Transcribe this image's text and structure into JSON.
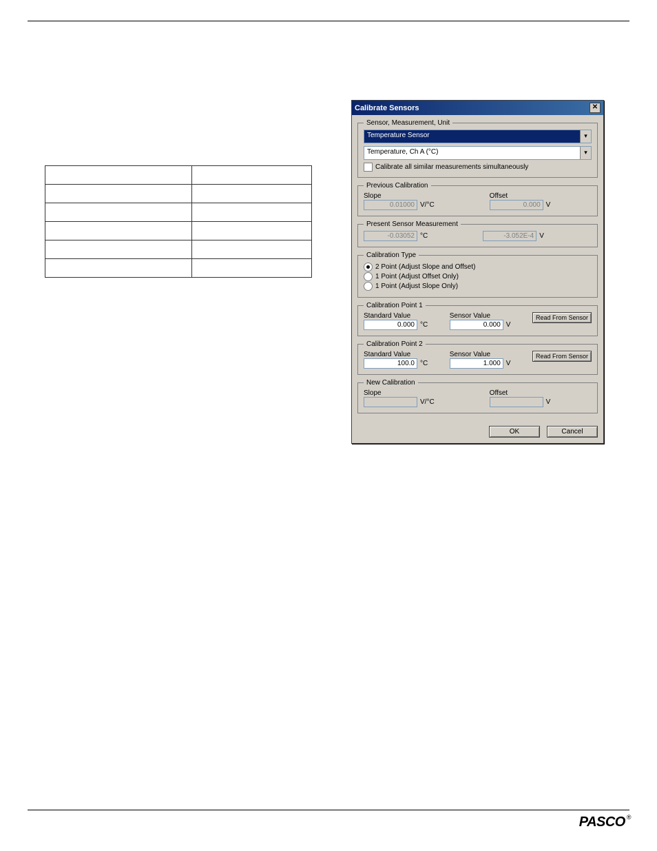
{
  "dialog": {
    "title": "Calibrate Sensors",
    "close_glyph": "✕",
    "smu": {
      "legend": "Sensor, Measurement, Unit",
      "sensor": "Temperature Sensor",
      "measurement": "Temperature, Ch A (°C)",
      "checkbox_label": "Calibrate all similar measurements simultaneously"
    },
    "prev_cal": {
      "legend": "Previous Calibration",
      "slope_label": "Slope",
      "slope_value": "0.01000",
      "slope_unit": "V/°C",
      "offset_label": "Offset",
      "offset_value": "0.000",
      "offset_unit": "V"
    },
    "present": {
      "legend": "Present Sensor Measurement",
      "value": "-0.03052",
      "unit": "°C",
      "raw_value": "-3.052E-4",
      "raw_unit": "V"
    },
    "cal_type": {
      "legend": "Calibration Type",
      "opt1": "2 Point (Adjust Slope and Offset)",
      "opt2": "1 Point (Adjust Offset Only)",
      "opt3": "1 Point (Adjust Slope Only)"
    },
    "cp1": {
      "legend": "Calibration Point 1",
      "std_label": "Standard Value",
      "std_value": "0.000",
      "std_unit": "°C",
      "sensor_label": "Sensor Value",
      "sensor_value": "0.000",
      "sensor_unit": "V",
      "read_btn": "Read From Sensor"
    },
    "cp2": {
      "legend": "Calibration Point 2",
      "std_label": "Standard Value",
      "std_value": "100.0",
      "std_unit": "°C",
      "sensor_label": "Sensor Value",
      "sensor_value": "1.000",
      "sensor_unit": "V",
      "read_btn": "Read From Sensor"
    },
    "new_cal": {
      "legend": "New Calibration",
      "slope_label": "Slope",
      "slope_value": "",
      "slope_unit": "V/°C",
      "offset_label": "Offset",
      "offset_value": "",
      "offset_unit": "V"
    },
    "buttons": {
      "ok": "OK",
      "cancel": "Cancel"
    }
  },
  "logo_text": "PASCO"
}
